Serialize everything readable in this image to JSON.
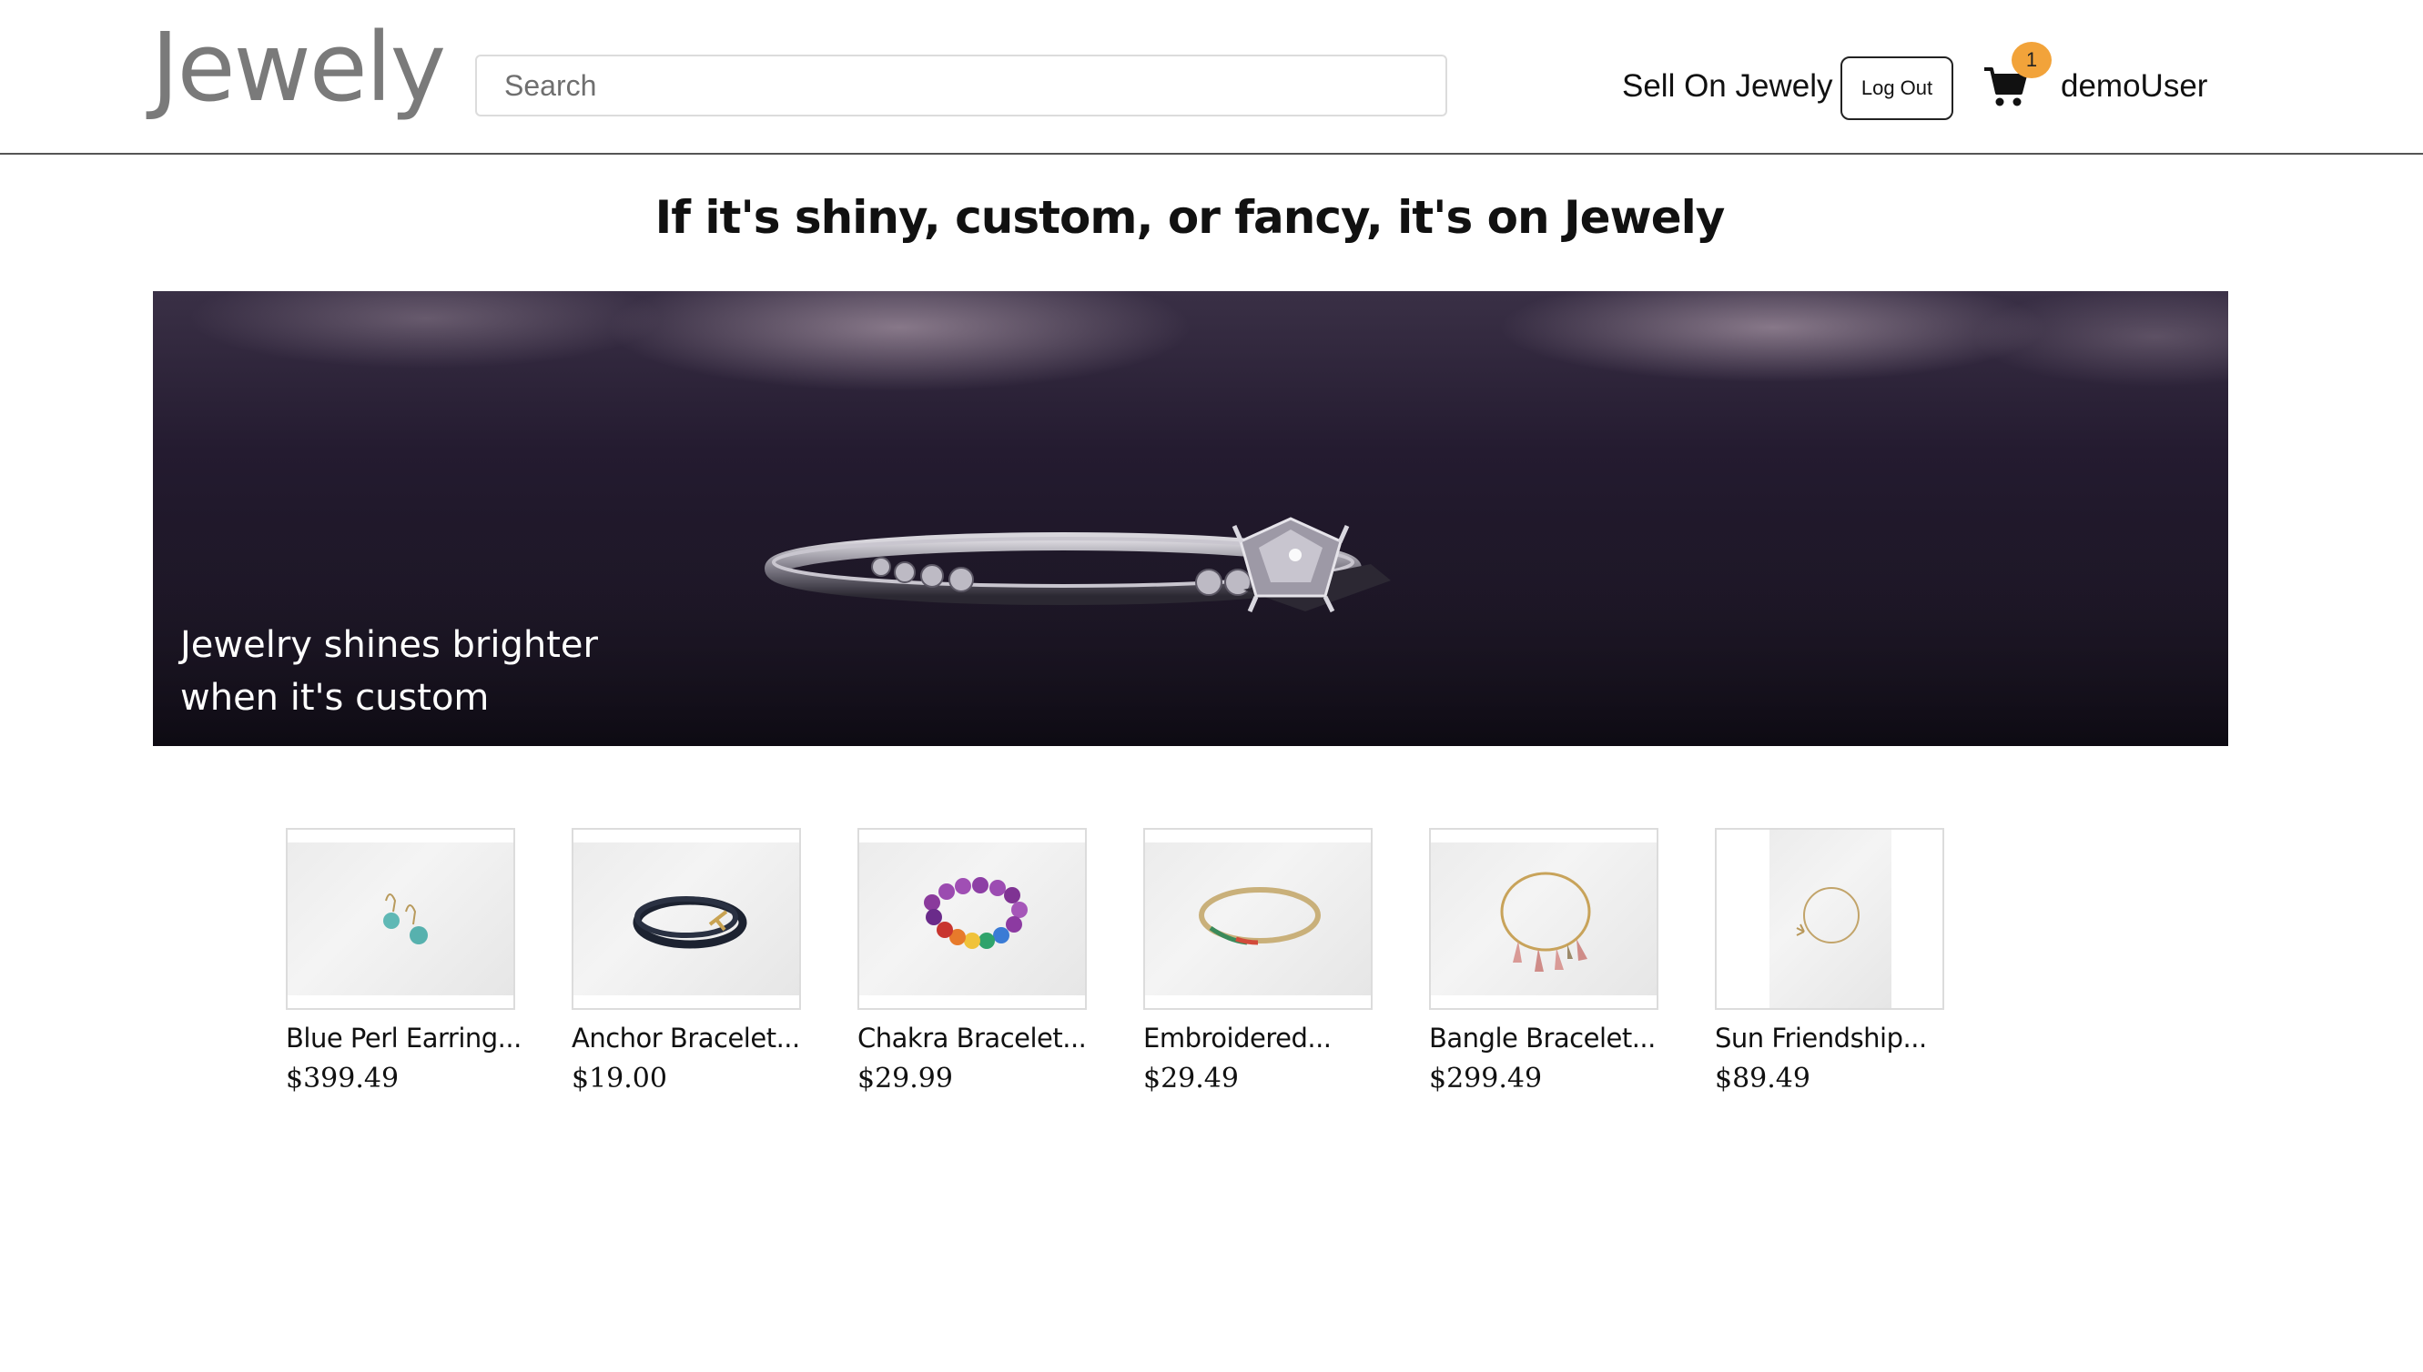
{
  "header": {
    "logo": "Jewely",
    "search_placeholder": "Search",
    "sell_label": "Sell On Jewely",
    "logout_label": "Log Out",
    "cart_count": "1",
    "username": "demoUser"
  },
  "tagline": "If it's shiny, custom, or fancy, it's on Jewely",
  "hero": {
    "caption_line1": "Jewelry shines brighter",
    "caption_line2": "when it's custom"
  },
  "products": [
    {
      "name": "Blue Perl Earring...",
      "price": "$399.49"
    },
    {
      "name": "Anchor Bracelet...",
      "price": "$19.00"
    },
    {
      "name": "Chakra Bracelet...",
      "price": "$29.99"
    },
    {
      "name": "Embroidered...",
      "price": "$29.49"
    },
    {
      "name": "Bangle Bracelet...",
      "price": "$299.49"
    },
    {
      "name": "Sun Friendship...",
      "price": "$89.49"
    }
  ],
  "colors": {
    "badge": "#f2a33a",
    "logo": "#7a7a7a",
    "hero_bg": "#1b1524"
  }
}
